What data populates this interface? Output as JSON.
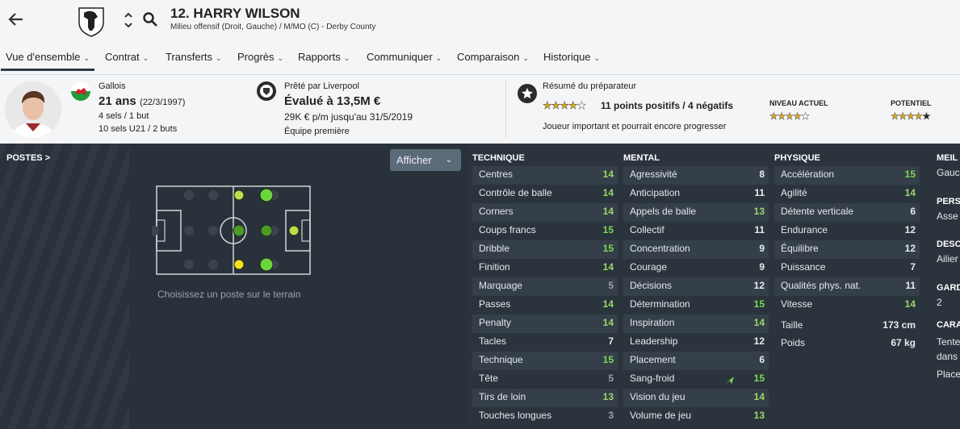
{
  "header": {
    "player_title": "12. HARRY WILSON",
    "player_role": "Milieu offensif (Droit, Gauche) / M/MO (C) - Derby County"
  },
  "tabs": [
    {
      "label": "Vue d'ensemble",
      "active": true
    },
    {
      "label": "Contrat"
    },
    {
      "label": "Transferts"
    },
    {
      "label": "Progrès"
    },
    {
      "label": "Rapports"
    },
    {
      "label": "Communiquer"
    },
    {
      "label": "Comparaison"
    },
    {
      "label": "Historique"
    }
  ],
  "info": {
    "nationality": "Gallois",
    "age": "21 ans",
    "dob": "(22/3/1997)",
    "caps": "4 sels / 1 but",
    "u21_caps": "10 sels U21 / 2 buts",
    "loan": "Prêté par Liverpool",
    "value": "Évalué à 13,5M €",
    "wage": "29K € p/m jusqu'au 31/5/2019",
    "squad": "Équipe première",
    "coach_report_label": "Résumé du préparateur",
    "coach_summary": "11 points positifs / 4 négatifs",
    "coach_stars": 4,
    "coach_note": "Joueur important et pourrait encore progresser",
    "current_label": "NIVEAU ACTUEL",
    "current_stars": 4,
    "potential_label": "POTENTIEL",
    "potential_stars": 5
  },
  "positions": {
    "title": "POSTES >",
    "show_button": "Afficher",
    "hint": "Choisissez un poste sur le terrain"
  },
  "attributes": {
    "technique": {
      "title": "TECHNIQUE",
      "items": [
        {
          "name": "Centres",
          "value": 14
        },
        {
          "name": "Contrôle de balle",
          "value": 14
        },
        {
          "name": "Corners",
          "value": 14
        },
        {
          "name": "Coups francs",
          "value": 15
        },
        {
          "name": "Dribble",
          "value": 15
        },
        {
          "name": "Finition",
          "value": 14
        },
        {
          "name": "Marquage",
          "value": 5
        },
        {
          "name": "Passes",
          "value": 14
        },
        {
          "name": "Penalty",
          "value": 14
        },
        {
          "name": "Tacles",
          "value": 7
        },
        {
          "name": "Technique",
          "value": 15
        },
        {
          "name": "Tête",
          "value": 5
        },
        {
          "name": "Tirs de loin",
          "value": 13
        },
        {
          "name": "Touches longues",
          "value": 3
        }
      ]
    },
    "mental": {
      "title": "MENTAL",
      "items": [
        {
          "name": "Agressivité",
          "value": 8
        },
        {
          "name": "Anticipation",
          "value": 11
        },
        {
          "name": "Appels de balle",
          "value": 13
        },
        {
          "name": "Collectif",
          "value": 11
        },
        {
          "name": "Concentration",
          "value": 9
        },
        {
          "name": "Courage",
          "value": 9
        },
        {
          "name": "Décisions",
          "value": 12
        },
        {
          "name": "Détermination",
          "value": 15
        },
        {
          "name": "Inspiration",
          "value": 14
        },
        {
          "name": "Leadership",
          "value": 12
        },
        {
          "name": "Placement",
          "value": 6
        },
        {
          "name": "Sang-froid",
          "value": 15
        },
        {
          "name": "Vision du jeu",
          "value": 14
        },
        {
          "name": "Volume de jeu",
          "value": 13
        }
      ]
    },
    "physique": {
      "title": "PHYSIQUE",
      "items": [
        {
          "name": "Accélération",
          "value": 15
        },
        {
          "name": "Agilité",
          "value": 14
        },
        {
          "name": "Détente verticale",
          "value": 6
        },
        {
          "name": "Endurance",
          "value": 12
        },
        {
          "name": "Équilibre",
          "value": 12
        },
        {
          "name": "Puissance",
          "value": 7
        },
        {
          "name": "Qualités phys. nat.",
          "value": 11
        },
        {
          "name": "Vitesse",
          "value": 14
        }
      ],
      "height_label": "Taille",
      "height": "173 cm",
      "weight_label": "Poids",
      "weight": "67 kg"
    }
  },
  "right_column": {
    "h1": "MEIL",
    "v1": "Gauc",
    "h2": "PERS",
    "v2": "Asse",
    "h3": "DESC",
    "v3": "Ailier",
    "h4": "GARD",
    "v4": "2",
    "h5": "CARA",
    "v5a": "Tente",
    "v5b": "dans",
    "v5c": "Place"
  },
  "colors": {
    "header_bg": "#f4f5f6",
    "panel_bg": "#29323b",
    "highlight_green": "#7ed954",
    "star_gold": "#e0a91d"
  }
}
